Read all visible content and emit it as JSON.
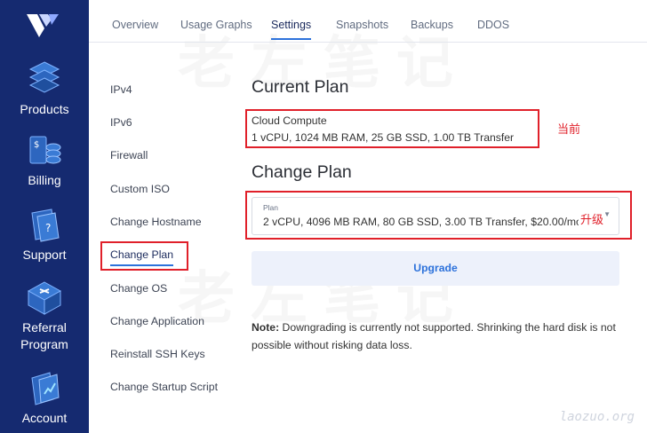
{
  "sidebar": {
    "items": [
      {
        "label": "Products",
        "icon": "products-icon"
      },
      {
        "label": "Billing",
        "icon": "billing-icon"
      },
      {
        "label": "Support",
        "icon": "support-icon"
      },
      {
        "label": "Referral\nProgram",
        "icon": "referral-icon"
      },
      {
        "label": "Account",
        "icon": "account-icon"
      }
    ]
  },
  "tabs": [
    {
      "label": "Overview",
      "active": false
    },
    {
      "label": "Usage Graphs",
      "active": false
    },
    {
      "label": "Settings",
      "active": true
    },
    {
      "label": "Snapshots",
      "active": false
    },
    {
      "label": "Backups",
      "active": false
    },
    {
      "label": "DDOS",
      "active": false
    }
  ],
  "submenu": [
    {
      "label": "IPv4"
    },
    {
      "label": "IPv6"
    },
    {
      "label": "Firewall"
    },
    {
      "label": "Custom ISO"
    },
    {
      "label": "Change Hostname"
    },
    {
      "label": "Change Plan",
      "active": true
    },
    {
      "label": "Change OS"
    },
    {
      "label": "Change Application"
    },
    {
      "label": "Reinstall SSH Keys"
    },
    {
      "label": "Change Startup Script"
    }
  ],
  "current_plan": {
    "heading": "Current Plan",
    "name": "Cloud Compute",
    "details": "1 vCPU, 1024 MB RAM, 25 GB SSD, 1.00 TB Transfer"
  },
  "change_plan": {
    "heading": "Change Plan",
    "field_label": "Plan",
    "selected_value": "2 vCPU, 4096 MB RAM, 80 GB SSD, 3.00 TB Transfer, $20.00/mo",
    "button": "Upgrade"
  },
  "note": {
    "prefix": "Note:",
    "text": " Downgrading is currently not supported. Shrinking the hard disk is not possible without risking data loss."
  },
  "annotations": {
    "current": "当前",
    "upgrade": "升级"
  },
  "watermark": {
    "text": "老左笔记",
    "site": "laozuo.org"
  },
  "colors": {
    "sidebar": "#152a70",
    "accent": "#2d72db",
    "annotation": "#e0202a"
  }
}
